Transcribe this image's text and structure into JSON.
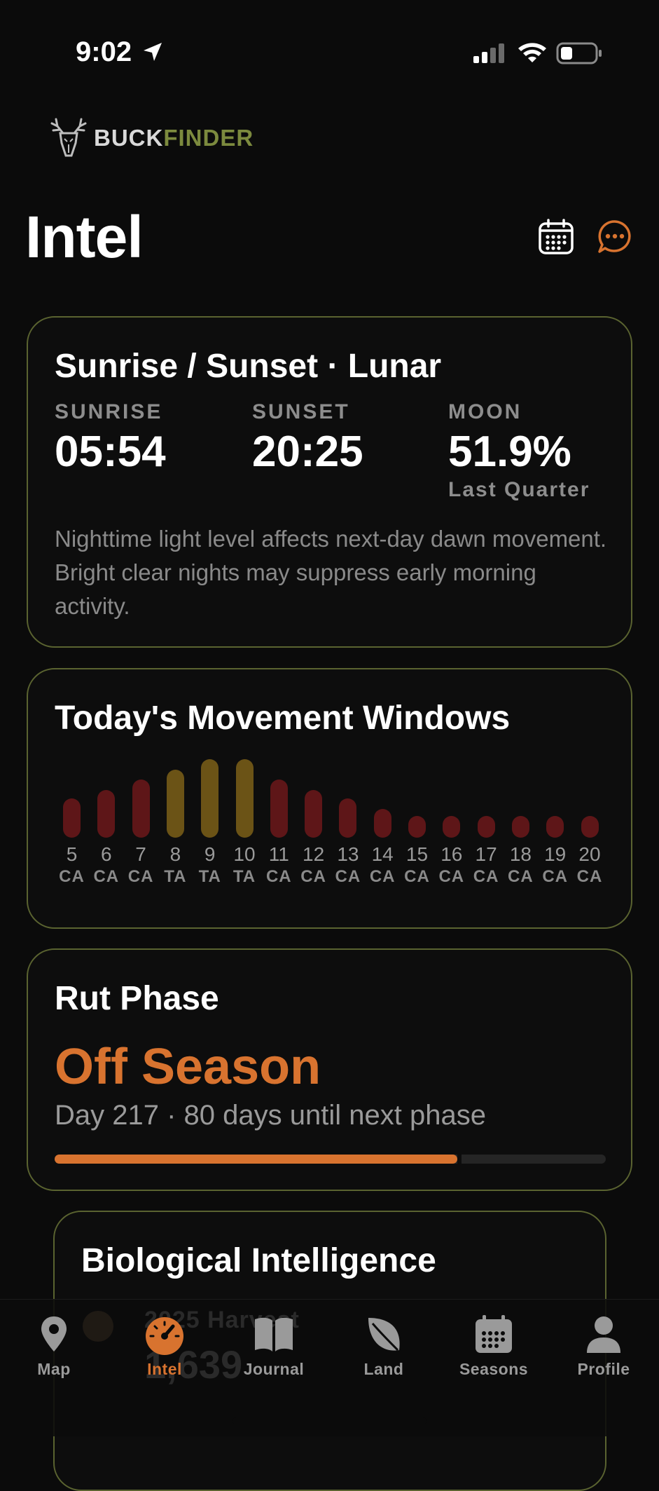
{
  "status_bar": {
    "time": "9:02"
  },
  "brand": {
    "word1": "BUCK",
    "word2": "FINDER"
  },
  "page_title": "Intel",
  "sun_card": {
    "title": "Sunrise / Sunset · Lunar",
    "sunrise_label": "SUNRISE",
    "sunrise_value": "05:54",
    "sunset_label": "SUNSET",
    "sunset_value": "20:25",
    "moon_label": "MOON",
    "moon_value": "51.9%",
    "moon_phase": "Last Quarter",
    "description": "Nighttime light level affects next-day dawn movement. Bright clear nights may suppress early morning activity."
  },
  "movement_card": {
    "title": "Today's Movement Windows",
    "colors": {
      "CA": "#5e1618",
      "TA": "#6b5316"
    },
    "hours": [
      {
        "hour": "5",
        "tag": "CA",
        "level": 0.45
      },
      {
        "hour": "6",
        "tag": "CA",
        "level": 0.55
      },
      {
        "hour": "7",
        "tag": "CA",
        "level": 0.67
      },
      {
        "hour": "8",
        "tag": "TA",
        "level": 0.78
      },
      {
        "hour": "9",
        "tag": "TA",
        "level": 0.9
      },
      {
        "hour": "10",
        "tag": "TA",
        "level": 0.9
      },
      {
        "hour": "11",
        "tag": "CA",
        "level": 0.67
      },
      {
        "hour": "12",
        "tag": "CA",
        "level": 0.55
      },
      {
        "hour": "13",
        "tag": "CA",
        "level": 0.45
      },
      {
        "hour": "14",
        "tag": "CA",
        "level": 0.33
      },
      {
        "hour": "15",
        "tag": "CA",
        "level": 0.25
      },
      {
        "hour": "16",
        "tag": "CA",
        "level": 0.25
      },
      {
        "hour": "17",
        "tag": "CA",
        "level": 0.25
      },
      {
        "hour": "18",
        "tag": "CA",
        "level": 0.25
      },
      {
        "hour": "19",
        "tag": "CA",
        "level": 0.25
      },
      {
        "hour": "20",
        "tag": "CA",
        "level": 0.25
      }
    ]
  },
  "rut_card": {
    "title": "Rut Phase",
    "phase": "Off Season",
    "days_text": "Day 217 · 80 days until next phase",
    "progress": 0.73
  },
  "bio_card": {
    "title": "Biological Intelligence"
  },
  "background_peek": {
    "harvest_label": "2025 Harvest",
    "harvest_count": "1,639"
  },
  "tabs": [
    {
      "label": "Map",
      "icon": "map-pin-icon",
      "active": false
    },
    {
      "label": "Intel",
      "icon": "speedometer-icon",
      "active": true
    },
    {
      "label": "Journal",
      "icon": "book-icon",
      "active": false
    },
    {
      "label": "Land",
      "icon": "leaf-icon",
      "active": false
    },
    {
      "label": "Seasons",
      "icon": "calendar-icon",
      "active": false
    },
    {
      "label": "Profile",
      "icon": "person-icon",
      "active": false
    }
  ],
  "accent_color": "#d8732f",
  "card_border_color": "#5a6330"
}
